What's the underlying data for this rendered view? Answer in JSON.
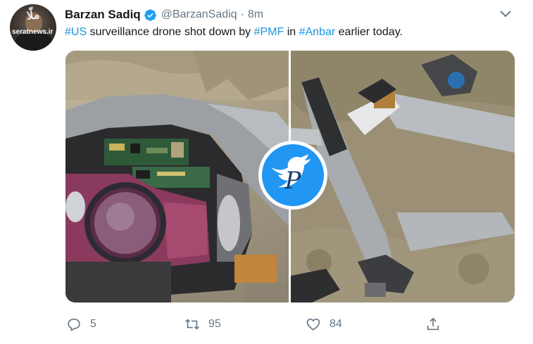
{
  "tweet": {
    "author_name": "Barzan Sadiq",
    "handle": "@BarzanSadiq",
    "separator": "·",
    "time": "8m",
    "avatar_watermark_top": "ملّا",
    "avatar_watermark_bottom": "seratnews.ir",
    "text_parts": [
      {
        "type": "hashtag",
        "value": "#US"
      },
      {
        "type": "text",
        "value": " surveillance drone shot down by "
      },
      {
        "type": "hashtag",
        "value": "#PMF"
      },
      {
        "type": "text",
        "value": " in "
      },
      {
        "type": "hashtag",
        "value": "#Anbar"
      },
      {
        "type": "text",
        "value": " earlier today."
      }
    ]
  },
  "media": {
    "images": [
      {
        "name": "drone-wreckage-camera-photo"
      },
      {
        "name": "drone-wreckage-fuselage-photo"
      }
    ],
    "watermark_letter": "P"
  },
  "actions": {
    "reply": {
      "icon": "reply-icon",
      "count": "5"
    },
    "retweet": {
      "icon": "retweet-icon",
      "count": "95"
    },
    "like": {
      "icon": "heart-icon",
      "count": "84"
    },
    "share": {
      "icon": "share-icon"
    }
  },
  "colors": {
    "accent": "#1b95e0",
    "text": "#14171a",
    "muted": "#657786",
    "verified": "#1da1f2"
  }
}
